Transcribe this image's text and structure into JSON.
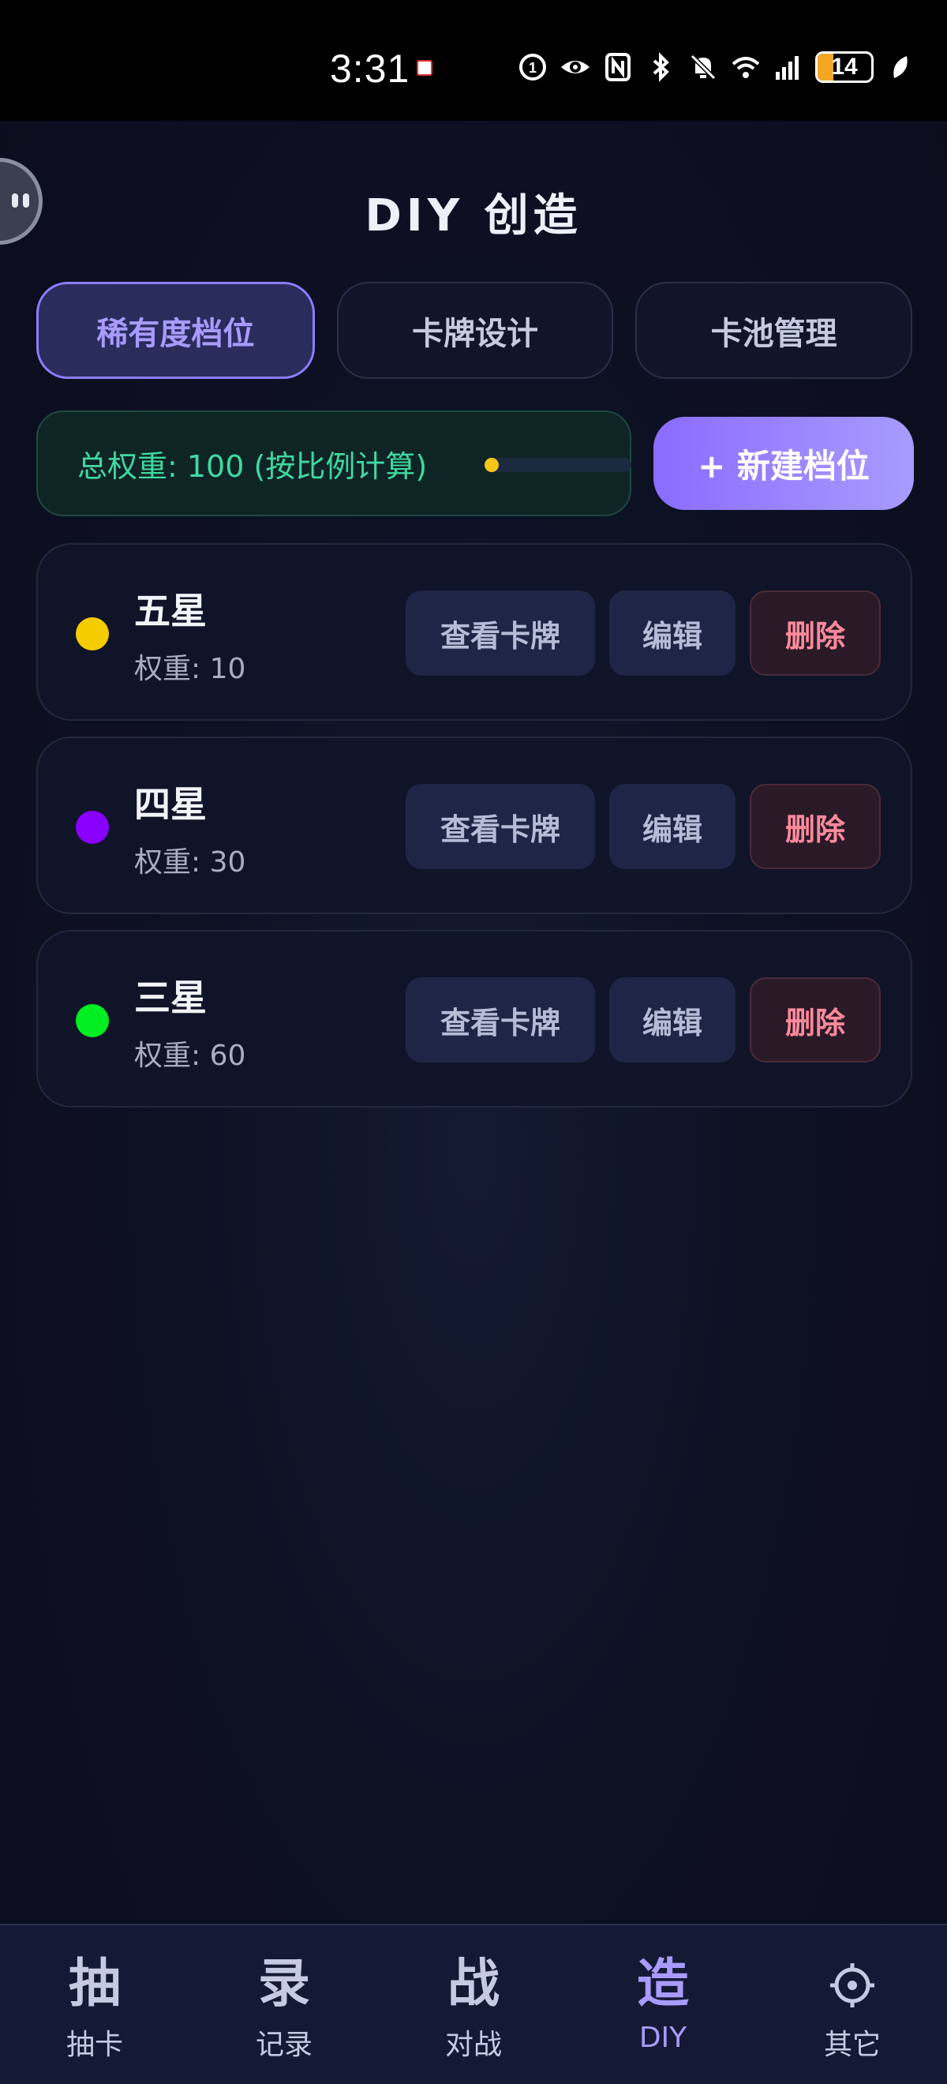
{
  "status_bar": {
    "time": "3:31",
    "battery": "14"
  },
  "header": {
    "title": "DIY 创造"
  },
  "tabs": [
    {
      "label": "稀有度档位",
      "active": true
    },
    {
      "label": "卡牌设计",
      "active": false
    },
    {
      "label": "卡池管理",
      "active": false
    }
  ],
  "weight": {
    "text": "总权重: 100 (按比例计算)",
    "indicator_color": "#f5c518"
  },
  "new_tier_button": "+ 新建档位",
  "tiers": [
    {
      "name": "五星",
      "weight": "权重: 10",
      "color": "#f5cc00",
      "view": "查看卡牌",
      "edit": "编辑",
      "delete": "删除"
    },
    {
      "name": "四星",
      "weight": "权重: 30",
      "color": "#8a00ff",
      "view": "查看卡牌",
      "edit": "编辑",
      "delete": "删除"
    },
    {
      "name": "三星",
      "weight": "权重: 60",
      "color": "#00ee22",
      "view": "查看卡牌",
      "edit": "编辑",
      "delete": "删除"
    }
  ],
  "bottom_nav": [
    {
      "icon": "抽",
      "label": "抽卡",
      "active": false
    },
    {
      "icon": "录",
      "label": "记录",
      "active": false
    },
    {
      "icon": "战",
      "label": "对战",
      "active": false
    },
    {
      "icon": "造",
      "label": "DIY",
      "active": true
    },
    {
      "icon": "gear-icon",
      "label": "其它",
      "active": false
    }
  ],
  "colors": {
    "accent": "#a99bff",
    "weight_text": "#3fd9a0",
    "delete_text": "#ff8a9c"
  }
}
